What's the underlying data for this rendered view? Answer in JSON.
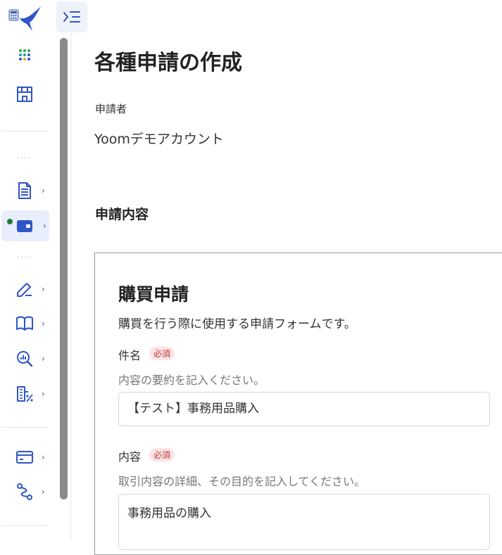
{
  "page": {
    "title": "各種申請の作成"
  },
  "applicant": {
    "label": "申請者",
    "value": "Yoomデモアカウント"
  },
  "section": {
    "title": "申請内容"
  },
  "form": {
    "title": "購買申請",
    "description": "購買を行う際に使用する申請フォームです。",
    "fields": [
      {
        "label": "件名",
        "required_badge": "必須",
        "help": "内容の要約を記入ください。",
        "value": "【テスト】事務用品購入"
      },
      {
        "label": "内容",
        "required_badge": "必須",
        "help": "取引内容の詳細、その目的を記入してください。",
        "value": "事務用品の購入"
      }
    ]
  },
  "sidebar": {
    "chevron": "›",
    "dots": "····",
    "items": [
      {
        "icon": "apps-grid-icon"
      },
      {
        "icon": "store-icon"
      },
      {
        "icon": "document-icon"
      },
      {
        "icon": "wallet-icon",
        "active": true
      },
      {
        "icon": "signature-icon"
      },
      {
        "icon": "book-icon"
      },
      {
        "icon": "analytics-search-icon"
      },
      {
        "icon": "building-percent-icon"
      },
      {
        "icon": "credit-card-icon"
      },
      {
        "icon": "workflow-icon"
      }
    ]
  },
  "colors": {
    "accent": "#2f55c8",
    "badge_bg": "#fbe3e6",
    "badge_text": "#c0392b"
  }
}
